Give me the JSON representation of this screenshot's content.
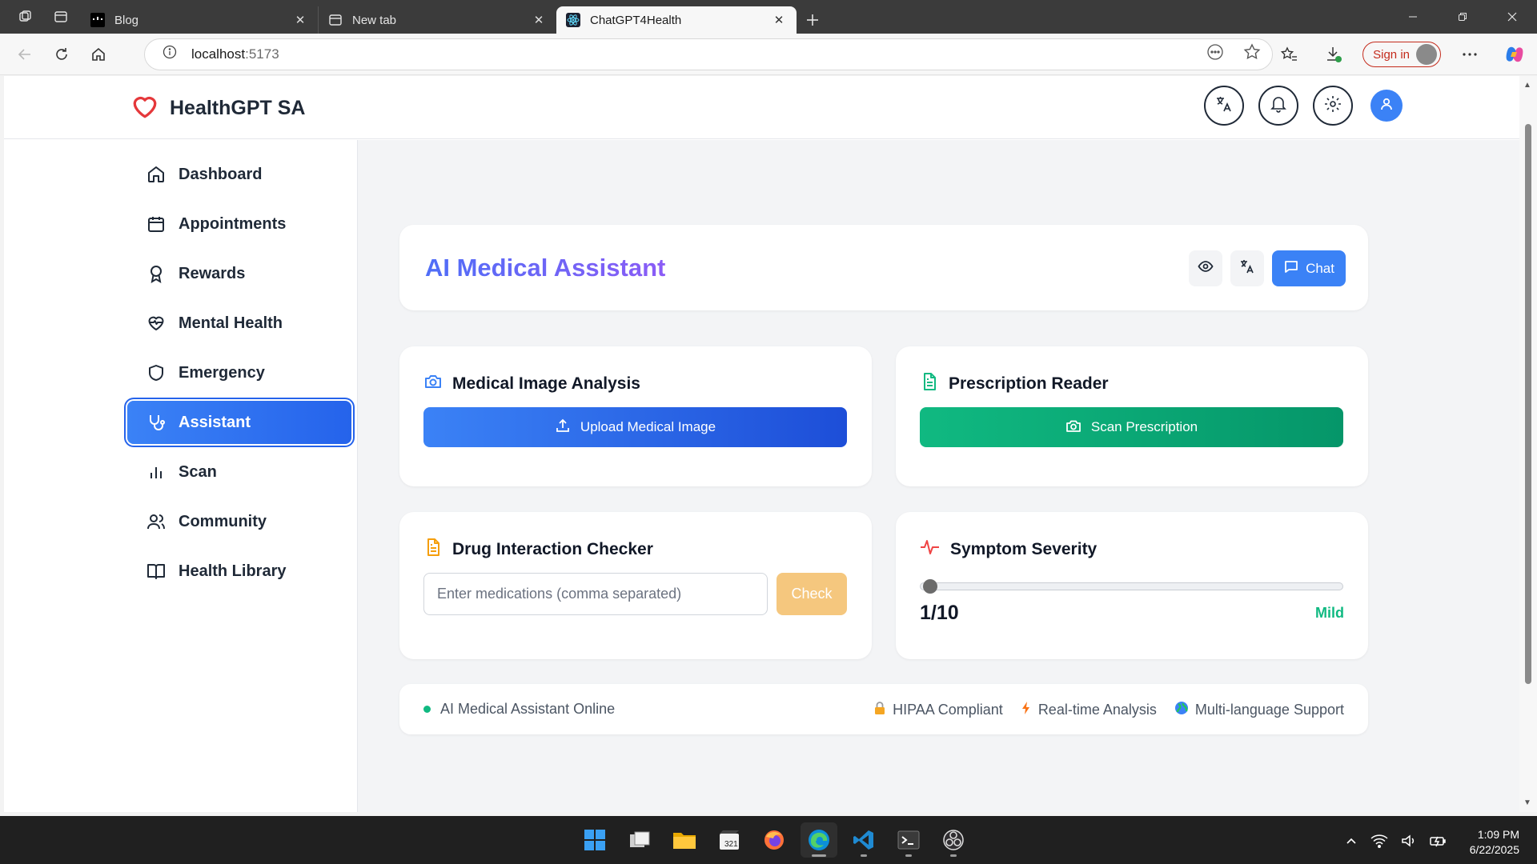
{
  "browser": {
    "tabs": [
      {
        "title": "Blog"
      },
      {
        "title": "New tab"
      },
      {
        "title": "ChatGPT4Health"
      }
    ],
    "url_host": "localhost",
    "url_port": ":5173",
    "signin_label": "Sign in"
  },
  "app": {
    "brand": "HealthGPT SA",
    "nav": [
      {
        "label": "Dashboard",
        "icon": "home-icon"
      },
      {
        "label": "Appointments",
        "icon": "calendar-icon"
      },
      {
        "label": "Rewards",
        "icon": "award-icon"
      },
      {
        "label": "Mental Health",
        "icon": "heart-pulse-icon"
      },
      {
        "label": "Emergency",
        "icon": "shield-icon"
      },
      {
        "label": "Assistant",
        "icon": "stethoscope-icon",
        "active": true
      },
      {
        "label": "Scan",
        "icon": "bar-chart-icon"
      },
      {
        "label": "Community",
        "icon": "users-icon"
      },
      {
        "label": "Health Library",
        "icon": "book-icon"
      }
    ]
  },
  "assistant": {
    "title": "AI Medical Assistant",
    "chat_label": "Chat",
    "image_analysis": {
      "title": "Medical Image Analysis",
      "button": "Upload Medical Image"
    },
    "prescription": {
      "title": "Prescription Reader",
      "button": "Scan Prescription"
    },
    "drug_checker": {
      "title": "Drug Interaction Checker",
      "placeholder": "Enter medications (comma separated)",
      "button": "Check"
    },
    "severity": {
      "title": "Symptom Severity",
      "value": 1,
      "max": 10,
      "display": "1/10",
      "label": "Mild"
    },
    "status": {
      "online": "AI Medical Assistant Online",
      "features": [
        "HIPAA Compliant",
        "Real-time Analysis",
        "Multi-language Support"
      ]
    }
  },
  "taskbar": {
    "time": "1:09 PM",
    "date": "6/22/2025"
  },
  "colors": {
    "accent": "#3b82f6",
    "green": "#10b981",
    "check_btn": "#f5c77e",
    "brand_heart": "#e5383b"
  }
}
